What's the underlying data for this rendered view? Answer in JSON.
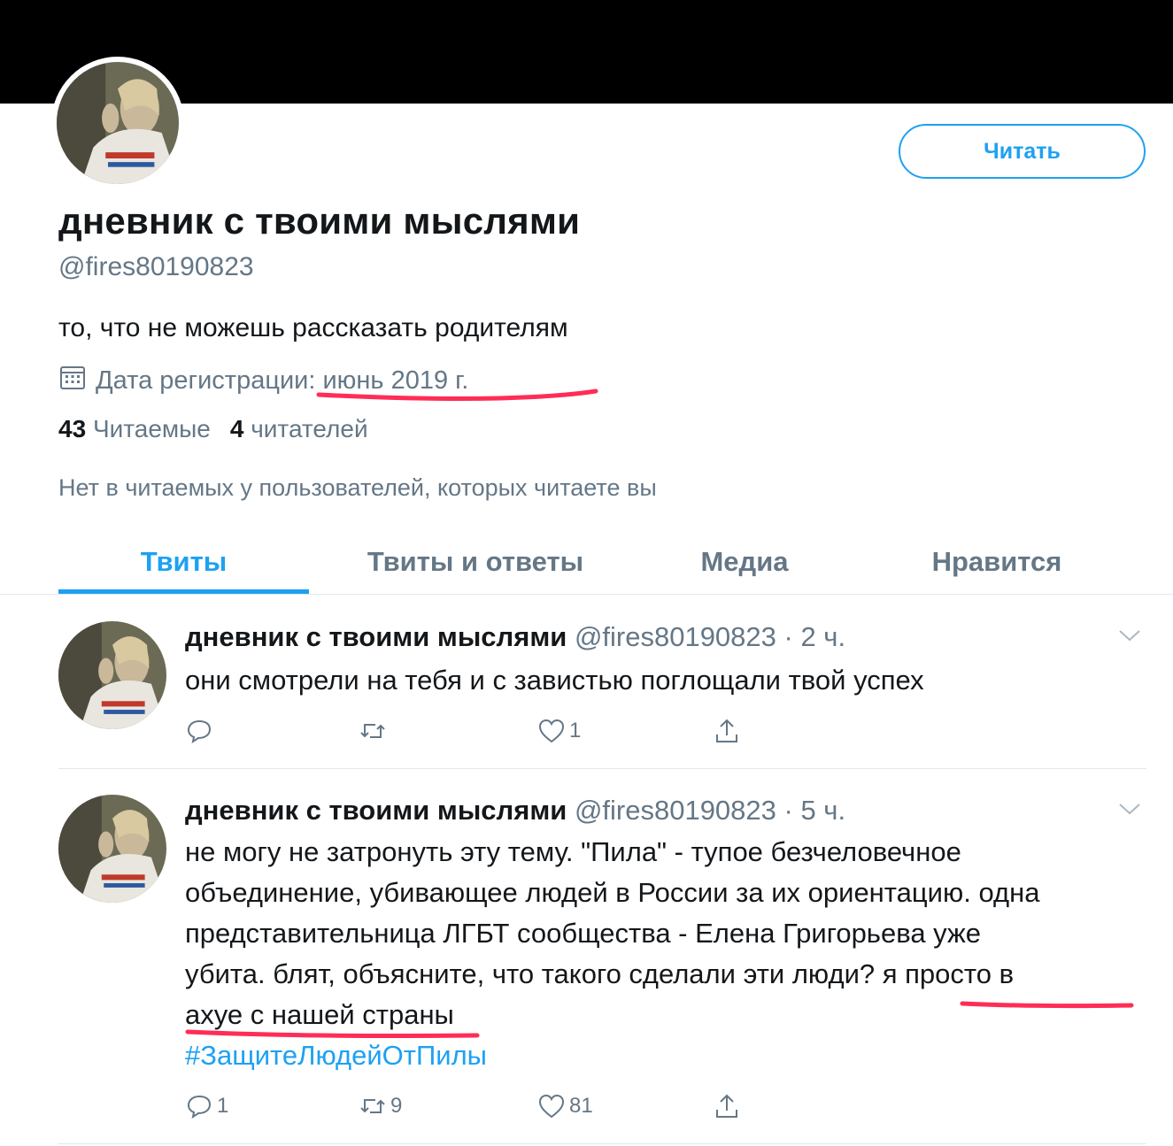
{
  "profile": {
    "name": "дневник с твоими мыслями",
    "handle": "@fires80190823",
    "bio": "то, что не можешь рассказать родителям",
    "joined": "Дата регистрации: июнь 2019 г.",
    "following_count": "43",
    "following_label": "Читаемые",
    "followers_count": "4",
    "followers_label": "читателей",
    "no_common": "Нет в читаемых у пользователей, которых читаете вы",
    "follow_button": "Читать"
  },
  "tabs": [
    {
      "label": "Твиты",
      "active": true
    },
    {
      "label": "Твиты и ответы",
      "active": false
    },
    {
      "label": "Медиа",
      "active": false
    },
    {
      "label": "Нравится",
      "active": false
    }
  ],
  "tweets": [
    {
      "name": "дневник с твоими мыслями",
      "meta": "@fires80190823 · 2 ч.",
      "text_lines": [
        "они смотрели на тебя и с завистью поглощали твой успех"
      ],
      "hashtag": "",
      "replies": "",
      "retweets": "",
      "likes": "1"
    },
    {
      "name": "дневник с твоими мыслями",
      "meta": "@fires80190823 · 5 ч.",
      "text_lines": [
        "не могу не затронуть эту тему. \"Пила\" - тупое безчеловечное",
        "объединение, убивающее людей в России за их ориентацию. одна",
        "представительница ЛГБТ сообщества - Елена Григорьева уже",
        "убита. блят, объясните, что такого сделали эти люди? я просто в",
        "ахуе с нашей страны"
      ],
      "hashtag": "#ЗащитеЛюдейОтПилы",
      "replies": "1",
      "retweets": "9",
      "likes": "81"
    }
  ],
  "colors": {
    "accent": "#1da1f2",
    "muted": "#657786",
    "marker": "#ff2d55"
  },
  "icons": [
    "calendar-icon",
    "reply-icon",
    "retweet-icon",
    "like-icon",
    "share-icon",
    "chevron-down-icon"
  ]
}
